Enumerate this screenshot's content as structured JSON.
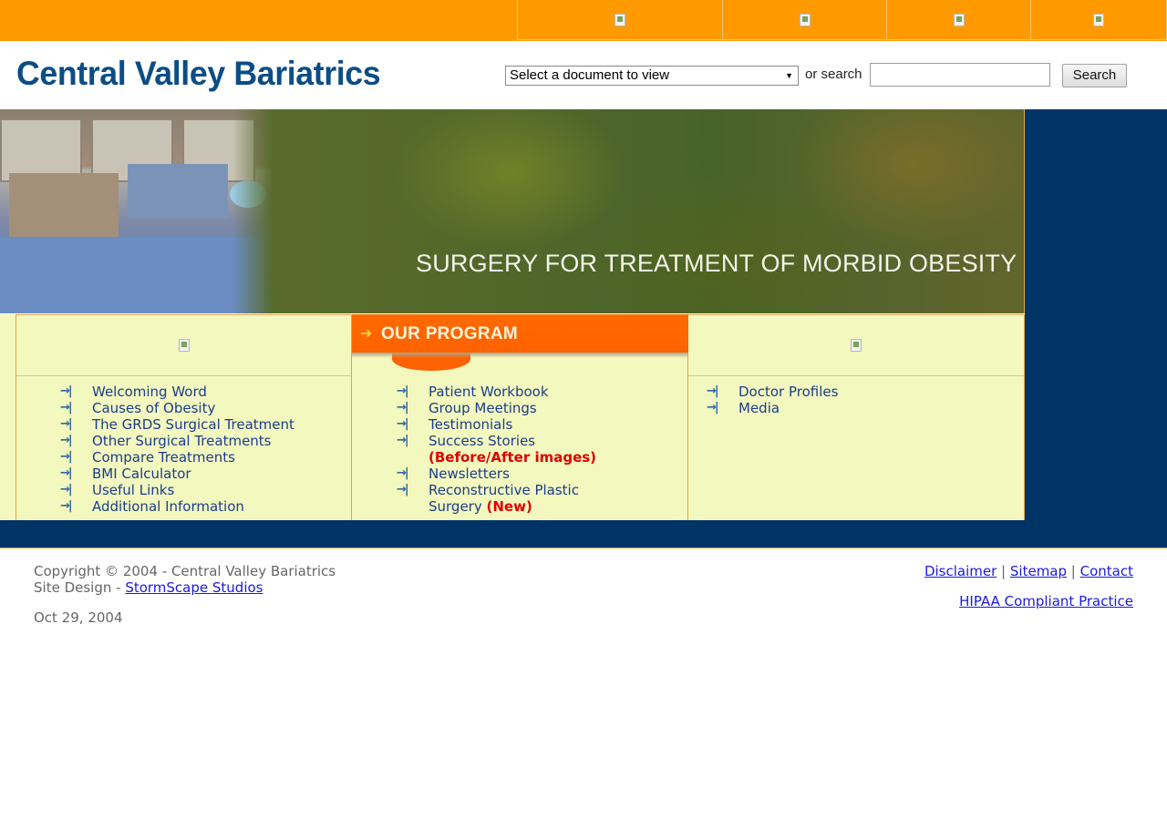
{
  "site": {
    "logo_text": "Central Valley Bariatrics",
    "top_nav_images": [
      "broken-image",
      "broken-image",
      "broken-image",
      "broken-image"
    ]
  },
  "search": {
    "select_value": "Select a document to view",
    "or_label": "or search",
    "input_value": "",
    "button_label": "Search"
  },
  "banner": {
    "title": "SURGERY FOR TREATMENT OF MORBID OBESITY"
  },
  "program_header": "OUR PROGRAM",
  "col1_items": [
    "Welcoming Word",
    "Causes of Obesity",
    "The GRDS Surgical Treatment",
    "Other Surgical Treatments",
    "Compare Treatments",
    "BMI Calculator",
    "Useful Links",
    "Additional Information"
  ],
  "col2_items": [
    {
      "label": "Patient Workbook"
    },
    {
      "label": "Group Meetings"
    },
    {
      "label": "Testimonials"
    },
    {
      "label": "Success Stories",
      "note": "(Before/After images)"
    },
    {
      "label": "Newsletters"
    },
    {
      "label": "Reconstructive Plastic",
      "label2": "Surgery",
      "note": "(New)"
    }
  ],
  "col3_items": [
    "Doctor Profiles",
    "Media"
  ],
  "footer": {
    "copyright": "Copyright © 2004 - Central Valley Bariatrics",
    "design_label": "Site Design - ",
    "design_link": "StormScape Studios",
    "date": "Oct 29, 2004",
    "links": [
      "Disclaimer",
      "Sitemap",
      "Contact"
    ],
    "separator": "|",
    "hipaa": "HIPAA Compliant Practice"
  },
  "colors": {
    "topbar": "#ff9900",
    "navy": "#003366",
    "panel": "#f3f8be",
    "program_orange": "#ff6200",
    "link_blue": "#1b3d8c",
    "accent_red": "#e00000"
  }
}
